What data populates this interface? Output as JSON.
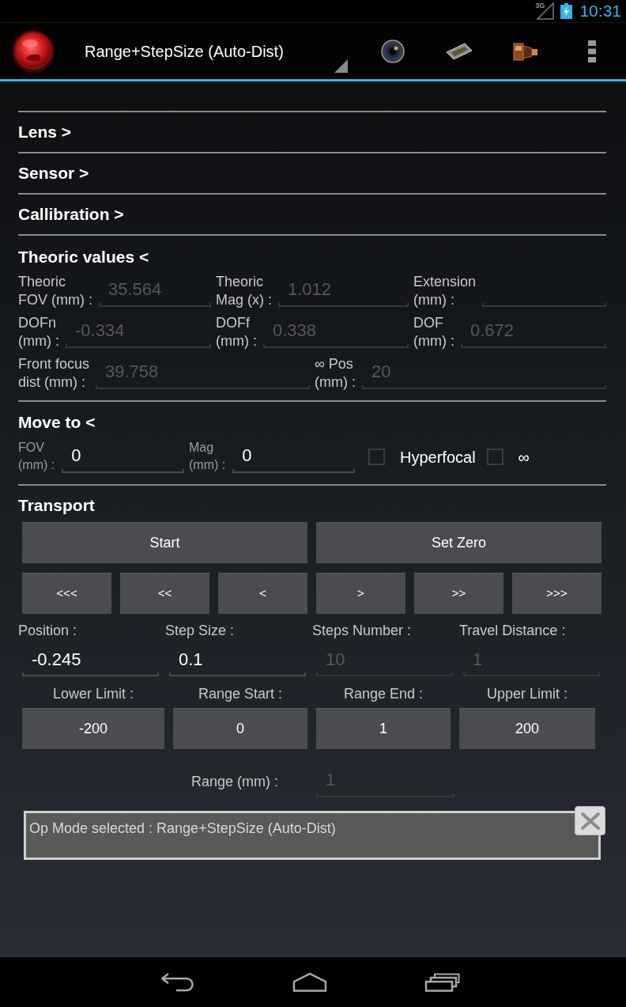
{
  "status_bar": {
    "network": "3G",
    "time": "10:31"
  },
  "action_bar": {
    "mode": "Range+StepSize (Auto-Dist)"
  },
  "sections": [
    {
      "title": "Lens >"
    },
    {
      "title": "Sensor >"
    },
    {
      "title": "Callibration >"
    }
  ],
  "theoric_values": {
    "title": "Theoric values <",
    "rows": [
      {
        "fields": [
          {
            "label": "Theoric\nFOV (mm) :",
            "value": "35.564",
            "disabled": true
          },
          {
            "label": "Theoric\nMag (x) :",
            "value": "1.012",
            "disabled": true
          },
          {
            "label": "Extension\n(mm) :",
            "disabled": true
          }
        ]
      },
      {
        "fields": [
          {
            "label": "DOFn\n(mm) :",
            "value": "-0.334",
            "disabled": true
          },
          {
            "label": "DOFf\n(mm) :",
            "value": "0.338",
            "disabled": true
          },
          {
            "label": "DOF\n(mm) :",
            "value": "0.672",
            "disabled": true
          }
        ]
      },
      {
        "fields": [
          {
            "label": "Front focus\ndist (mm) :",
            "value": "39.758",
            "disabled": true
          },
          {
            "label": "∞ Pos\n(mm) :",
            "value": "20",
            "disabled": true
          }
        ]
      }
    ]
  },
  "move_to": {
    "title": "Move to <",
    "fields": [
      {
        "label": "FOV\n(mm) :",
        "value": "0",
        "disabled": false
      },
      {
        "label": "Mag\n(mm) :",
        "value": "0",
        "disabled": false
      }
    ],
    "checkboxes": [
      {
        "label": "Hyperfocal",
        "checked": false
      },
      {
        "label": "∞",
        "checked": false
      }
    ]
  },
  "transport": {
    "title": "Transport",
    "buttons": [
      "Start",
      "Set Zero"
    ],
    "step_buttons": [
      "<<<",
      "<<",
      "<",
      ">",
      ">>",
      ">>>"
    ],
    "fields": [
      {
        "label": "Position :",
        "value": "-0.245",
        "disabled": false
      },
      {
        "label": "Step Size :",
        "value": "0.1",
        "disabled": false
      },
      {
        "label": "Steps Number :",
        "value": "10",
        "disabled": true
      },
      {
        "label": "Travel Distance :",
        "value": "1",
        "disabled": true
      }
    ],
    "limits": [
      {
        "label": "Lower Limit :",
        "value": "-200"
      },
      {
        "label": "Range Start :",
        "value": "0"
      },
      {
        "label": "Range End :",
        "value": "1"
      },
      {
        "label": "Upper Limit :",
        "value": "200"
      }
    ],
    "range": {
      "label": "Range (mm) :",
      "value": "1",
      "disabled": true
    }
  },
  "message": {
    "text": "Op Mode selected : Range+StepSize (Auto-Dist)"
  }
}
